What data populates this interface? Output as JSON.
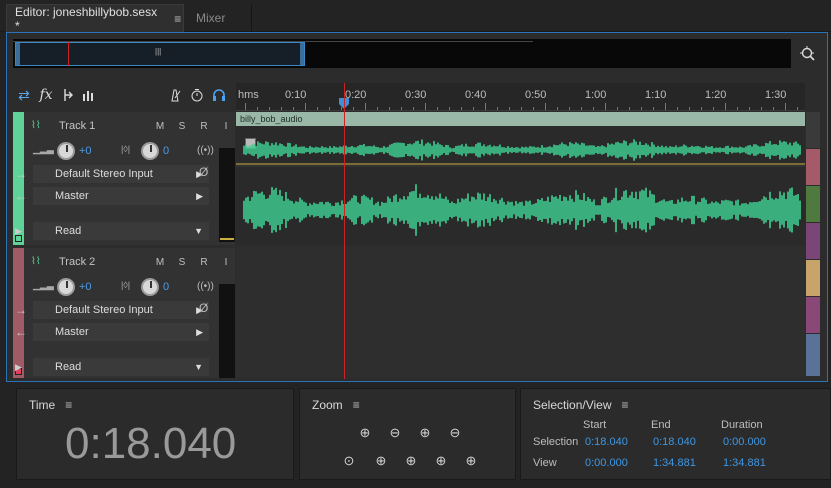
{
  "tabs": {
    "editor": "Editor: joneshbillybob.sesx *",
    "mixer": "Mixer"
  },
  "ruler": {
    "unit": "hms",
    "ticks": [
      "0:10",
      "0:20",
      "0:30",
      "0:40",
      "0:50",
      "1:00",
      "1:10",
      "1:20",
      "1:30"
    ]
  },
  "tracks": [
    {
      "name": "Track 1",
      "m": "M",
      "s": "S",
      "r": "R",
      "i": "I",
      "volume": "+0",
      "pan": "0",
      "input": "Default Stereo Input",
      "output": "Master",
      "automation": "Read",
      "color": "#5fd29a"
    },
    {
      "name": "Track 2",
      "m": "M",
      "s": "S",
      "r": "R",
      "i": "I",
      "volume": "+0",
      "pan": "0",
      "input": "Default Stereo Input",
      "output": "Master",
      "automation": "Read",
      "color": "#a15b66"
    }
  ],
  "clip": {
    "name": "billy_bob_audio",
    "wave_color": "#3ecf92"
  },
  "track_colors": [
    "#a45a68",
    "#4e7a3f",
    "#7a4577",
    "#7a4577",
    "#c9a46a",
    "#8a4878",
    "#5a7298"
  ],
  "time_panel": {
    "title": "Time",
    "value": "0:18.040"
  },
  "zoom_panel": {
    "title": "Zoom"
  },
  "selection_panel": {
    "title": "Selection/View",
    "headers": {
      "start": "Start",
      "end": "End",
      "duration": "Duration"
    },
    "selection": {
      "label": "Selection",
      "start": "0:18.040",
      "end": "0:18.040",
      "duration": "0:00.000"
    },
    "view": {
      "label": "View",
      "start": "0:00.000",
      "end": "1:34.881",
      "duration": "1:34.881"
    }
  }
}
